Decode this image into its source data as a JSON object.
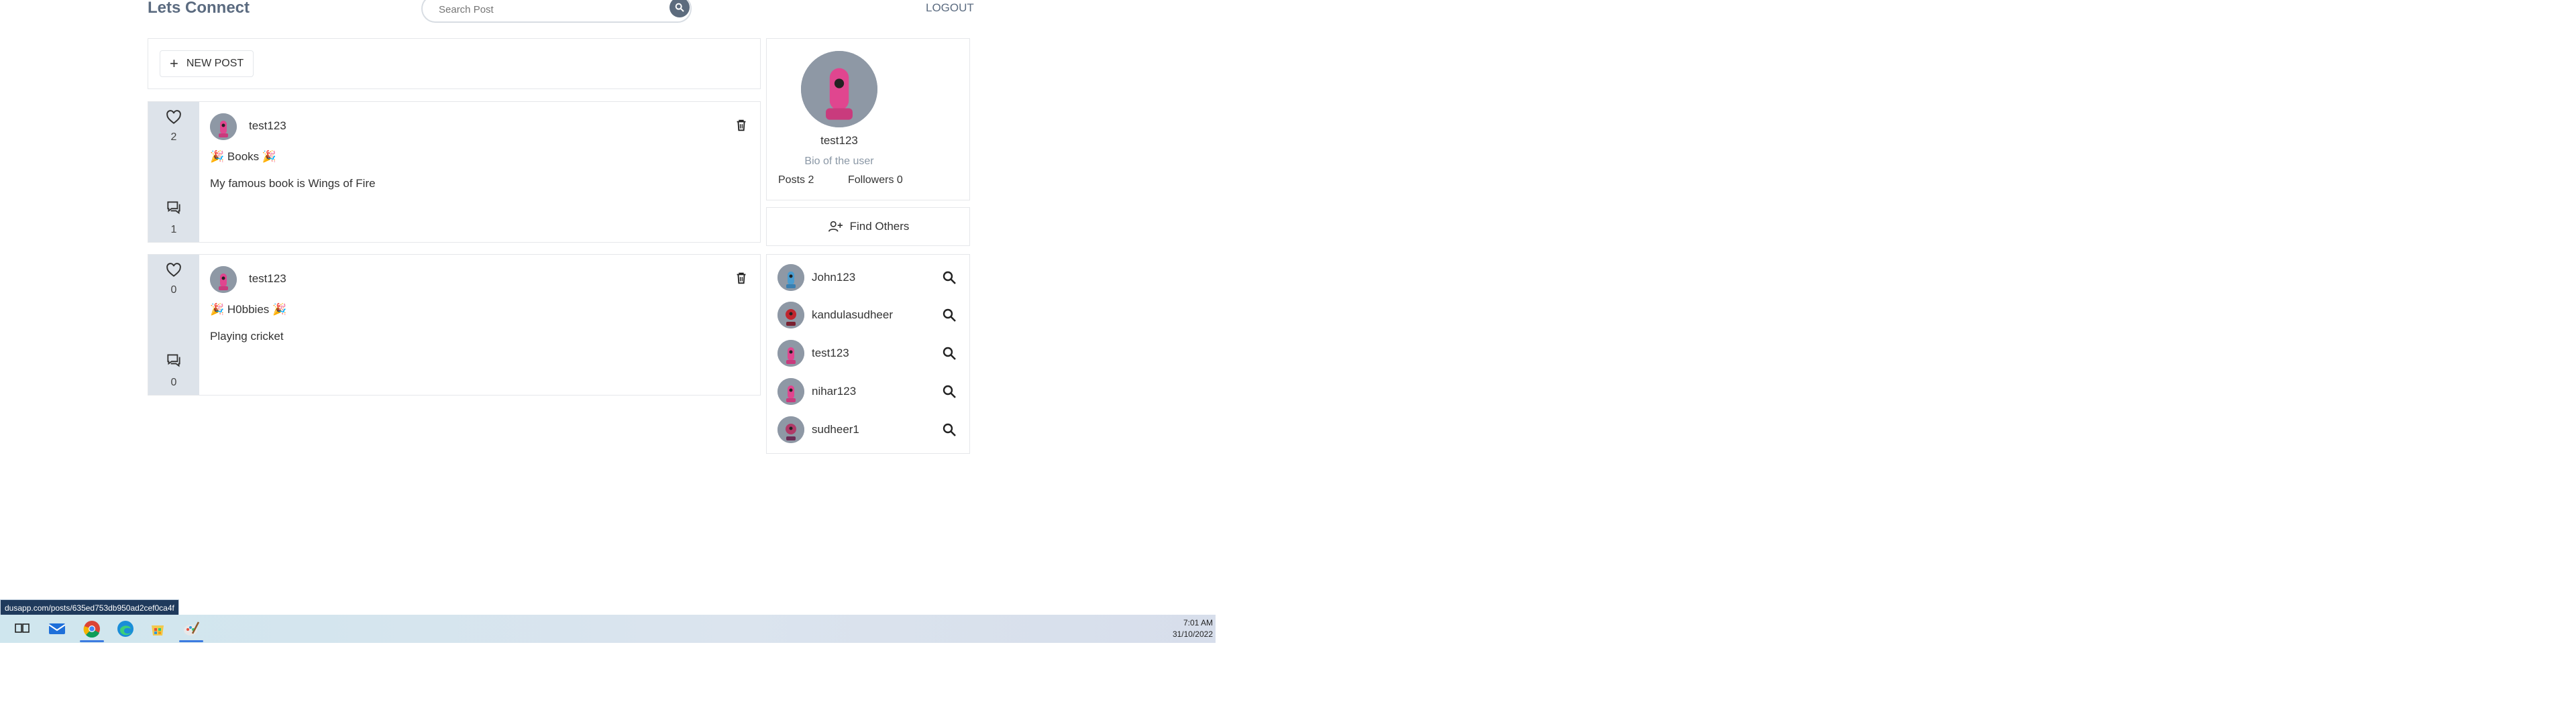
{
  "header": {
    "brand": "Lets Connect",
    "search_placeholder": "Search Post",
    "logout": "LOGOUT"
  },
  "new_post": {
    "label": "NEW POST"
  },
  "posts": [
    {
      "likes": "2",
      "comments": "1",
      "user": "test123",
      "topic": "Books",
      "body": "My famous book is Wings of Fire"
    },
    {
      "likes": "0",
      "comments": "0",
      "user": "test123",
      "topic": "H0bbies",
      "body": "Playing cricket"
    }
  ],
  "profile": {
    "name": "test123",
    "bio": "Bio of the user",
    "posts": "Posts 2",
    "followers": "Followers 0"
  },
  "find_others": {
    "label": "Find Others"
  },
  "users": [
    {
      "name": "John123"
    },
    {
      "name": "kandulasudheer"
    },
    {
      "name": "test123"
    },
    {
      "name": "nihar123"
    },
    {
      "name": "sudheer1"
    }
  ],
  "status_url": "dusapp.com/posts/635ed753db950ad2cef0ca4f",
  "taskbar": {
    "time": "7:01 AM",
    "date": "31/10/2022"
  },
  "colors": {
    "brand": "#5b6b80",
    "accent_bar": "#dde3ea",
    "avatar_bg": "#8e98a5",
    "robot_pink": "#e0468f",
    "bio_text": "#8a97a5"
  }
}
